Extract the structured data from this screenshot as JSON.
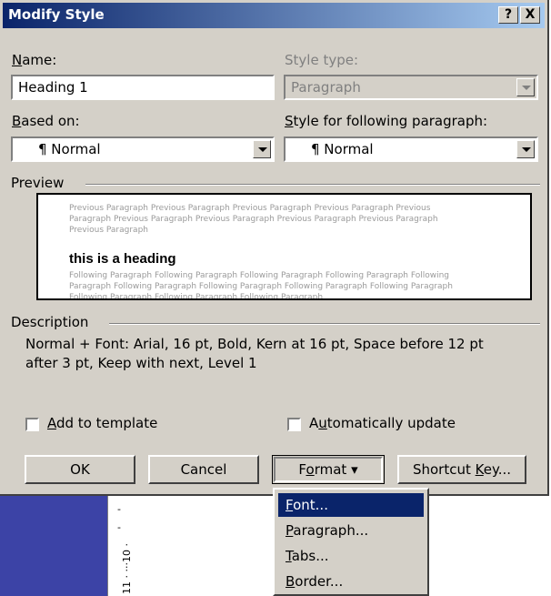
{
  "dialog": {
    "title": "Modify Style",
    "help_btn": "?",
    "close_btn": "X"
  },
  "name": {
    "label_u": "N",
    "label_rest": "ame:",
    "value": "Heading 1"
  },
  "style_type": {
    "label": "Style type:",
    "value": "Paragraph"
  },
  "based_on": {
    "label_u": "B",
    "label_rest": "ased on:",
    "value": "¶ Normal"
  },
  "following": {
    "label_u": "S",
    "label_rest": "tyle for following paragraph:",
    "value": "¶ Normal"
  },
  "preview": {
    "label": "Preview",
    "prev_lines": [
      "Previous Paragraph Previous Paragraph Previous Paragraph Previous Paragraph Previous",
      "Paragraph Previous Paragraph Previous Paragraph Previous Paragraph Previous Paragraph",
      "Previous Paragraph"
    ],
    "heading": "this is a heading",
    "follow_lines": [
      "Following Paragraph Following Paragraph Following Paragraph Following Paragraph Following",
      "Paragraph Following Paragraph Following Paragraph Following Paragraph Following Paragraph",
      "Following Paragraph Following Paragraph Following Paragraph"
    ]
  },
  "description": {
    "label": "Description",
    "line1": "Normal + Font: Arial, 16 pt, Bold, Kern at 16 pt, Space before 12 pt",
    "line2": "after 3 pt, Keep with next, Level 1"
  },
  "add_template": {
    "label_u": "A",
    "label_rest": "dd to template",
    "checked": false
  },
  "auto_update": {
    "label_pre": "A",
    "label_u": "u",
    "label_rest": "tomatically update",
    "checked": false
  },
  "buttons": {
    "ok": "OK",
    "cancel": "Cancel",
    "format_u": "o",
    "format_pre": "F",
    "format_rest": "rmat",
    "format_arrow": "▾",
    "shortcut_pre": "Shortcut ",
    "shortcut_u": "K",
    "shortcut_rest": "ey..."
  },
  "ruler": {
    "mark10": "· 10 ·",
    "mark11": "11 · · ·"
  },
  "format_menu": [
    {
      "u": "F",
      "rest": "ont...",
      "selected": true
    },
    {
      "u": "P",
      "rest": "aragraph...",
      "selected": false
    },
    {
      "u": "T",
      "rest": "abs...",
      "selected": false
    },
    {
      "u": "B",
      "rest": "order...",
      "selected": false
    }
  ]
}
